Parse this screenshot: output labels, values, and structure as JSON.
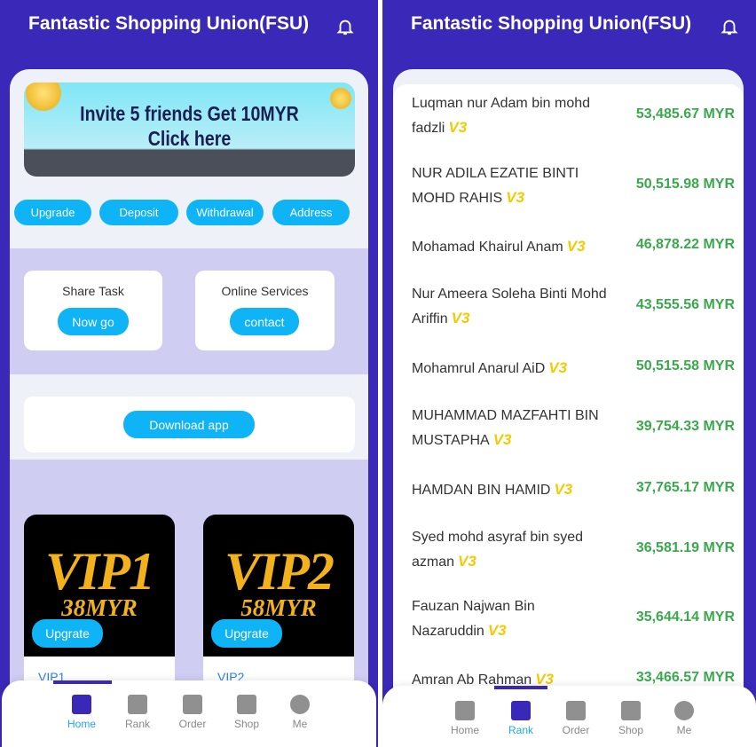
{
  "app_title": "Fantastic Shopping Union(FSU)",
  "home": {
    "banner": {
      "line1": "Invite 5 friends     Get 10MYR",
      "line2": "Click here"
    },
    "actions": [
      "Upgrade",
      "Deposit",
      "Withdrawal",
      "Address"
    ],
    "share_task": {
      "label": "Share Task",
      "button": "Now go"
    },
    "online_services": {
      "label": "Online Services",
      "button": "contact"
    },
    "download_button": "Download app",
    "vip_cards": [
      {
        "title": "VIP1",
        "price": "38MYR",
        "button": "Upgrate",
        "name": "VIP1"
      },
      {
        "title": "VIP2",
        "price": "58MYR",
        "button": "Upgrate",
        "name": "VIP2"
      }
    ]
  },
  "rank": {
    "level_badge": "V3",
    "rows": [
      {
        "name": "Luqman nur Adam bin mohd fadzli",
        "amount": "53,485.67 MYR"
      },
      {
        "name": "NUR ADILA EZATIE BINTI MOHD RAHIS",
        "amount": "50,515.98 MYR"
      },
      {
        "name": "Mohamad Khairul Anam",
        "amount": "46,878.22 MYR"
      },
      {
        "name": "Nur Ameera Soleha Binti Mohd Ariffin",
        "amount": "43,555.56 MYR"
      },
      {
        "name": "Mohamrul Anarul AiD",
        "amount": "50,515.58 MYR"
      },
      {
        "name": "MUHAMMAD MAZFAHTI BIN MUSTAPHA",
        "amount": "39,754.33 MYR"
      },
      {
        "name": "HAMDAN BIN HAMID",
        "amount": "37,765.17 MYR"
      },
      {
        "name": "Syed mohd asyraf bin syed azman",
        "amount": "36,581.19 MYR"
      },
      {
        "name": "Fauzan Najwan Bin Nazaruddin",
        "amount": "35,644.14 MYR"
      },
      {
        "name": "Amran Ab Rahman",
        "amount": "33,466.57 MYR"
      }
    ]
  },
  "nav": [
    {
      "label": "Home",
      "icon": "home-icon"
    },
    {
      "label": "Rank",
      "icon": "rank-icon"
    },
    {
      "label": "Order",
      "icon": "order-icon"
    },
    {
      "label": "Shop",
      "icon": "shop-icon"
    },
    {
      "label": "Me",
      "icon": "user-icon"
    }
  ],
  "colors": {
    "primary": "#3a28b8",
    "accent": "#0eb4f5",
    "amount": "#3aa94c",
    "badge": "#f2cc00",
    "section": "#d0cdf3"
  }
}
